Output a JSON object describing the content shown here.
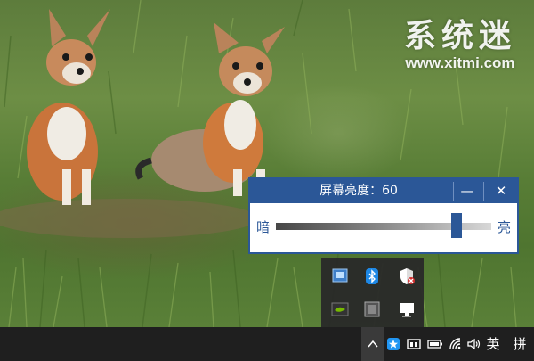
{
  "watermark": {
    "name_cn": "系统迷",
    "url": "www.xitmi.com"
  },
  "brightness_dialog": {
    "title": "屏幕亮度：60",
    "minimize_glyph": "—",
    "close_glyph": "✕",
    "label_dark": "暗",
    "label_bright": "亮",
    "level": 60,
    "accent_color": "#2b5797"
  },
  "tray_flyout": {
    "icons": [
      "display-settings-icon",
      "bluetooth-icon",
      "windows-defender-icon",
      "nvidia-icon",
      "storage-device-icon",
      "monitor-icon"
    ]
  },
  "taskbar": {
    "tray_icons": [
      "show-hidden-icons-chevron",
      "app-star-icon",
      "window-icon",
      "battery-icon",
      "wifi-icon",
      "volume-icon"
    ],
    "language_indicator": "英",
    "ime_indicator": "拼"
  }
}
